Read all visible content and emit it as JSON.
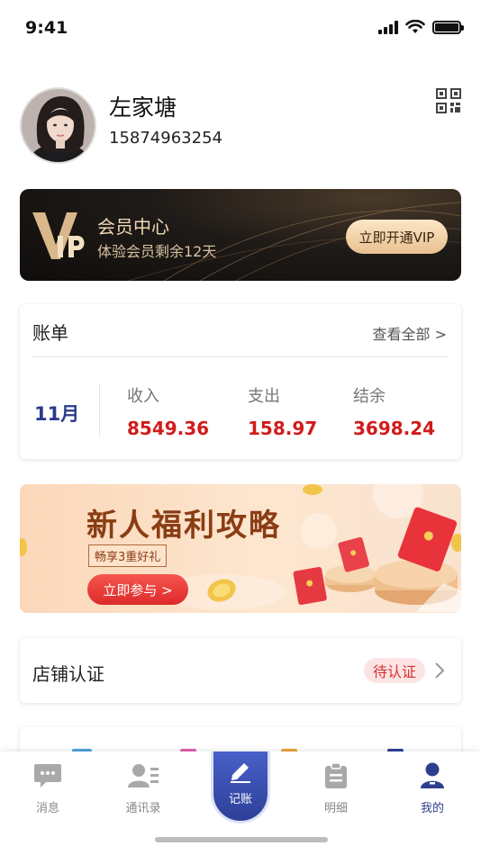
{
  "status_bar": {
    "time": "9:41"
  },
  "profile": {
    "name": "左家塘",
    "phone": "15874963254"
  },
  "vip": {
    "title": "会员中心",
    "subtitle": "体验会员剩余12天",
    "button_label": "立即开通VIP"
  },
  "bill": {
    "title": "账单",
    "view_all": "查看全部 >",
    "month": "11月",
    "income_label": "收入",
    "income_value": "8549.36",
    "expense_label": "支出",
    "expense_value": "158.97",
    "balance_label": "结余",
    "balance_value": "3698.24"
  },
  "promo": {
    "title": "新人福利攻略",
    "subtitle": "畅享3重好礼",
    "button_label": "立即参与 >"
  },
  "shop": {
    "title": "店铺认证",
    "status": "待认证"
  },
  "tabbar": {
    "messages": "消息",
    "contacts": "通讯录",
    "record": "记账",
    "details": "明细",
    "mine": "我的"
  },
  "colors": {
    "accent": "#2d3f98",
    "amount_red": "#d21b1b",
    "vip_gold": "#f1d9b5"
  }
}
